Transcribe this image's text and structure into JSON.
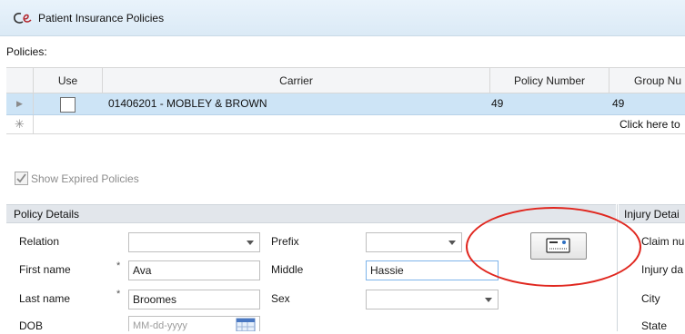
{
  "window": {
    "title": "Patient Insurance Policies"
  },
  "policies": {
    "label": "Policies:",
    "columns": [
      "Use",
      "Carrier",
      "Policy Number",
      "Group Nu"
    ],
    "rows": [
      {
        "carrier": "01406201 - MOBLEY & BROWN",
        "policy_number": "49",
        "group_number": "49"
      }
    ],
    "new_row_hint": "Click here to"
  },
  "show_expired": {
    "label": "Show Expired Policies",
    "checked": true
  },
  "policy_details": {
    "header": "Policy Details",
    "relation": {
      "label": "Relation",
      "value": ""
    },
    "prefix": {
      "label": "Prefix",
      "value": ""
    },
    "first_name": {
      "label": "First name",
      "value": "Ava"
    },
    "middle": {
      "label": "Middle",
      "value": "Hassie"
    },
    "last_name": {
      "label": "Last name",
      "value": "Broomes"
    },
    "sex": {
      "label": "Sex",
      "value": ""
    },
    "dob": {
      "label": "DOB",
      "placeholder": "MM-dd-yyyy"
    },
    "required_marker": "*"
  },
  "injury_details": {
    "header": "Injury Detai",
    "labels": [
      "Claim nu",
      "Injury da",
      "City",
      "State"
    ]
  },
  "colors": {
    "annotation": "#e0271f",
    "selected_row": "#cde4f6",
    "title_bar": "#e3eff9"
  },
  "icons": {
    "app": "ce-logo-icon",
    "card_reader": "card-scan-icon",
    "calendar": "calendar-icon"
  }
}
